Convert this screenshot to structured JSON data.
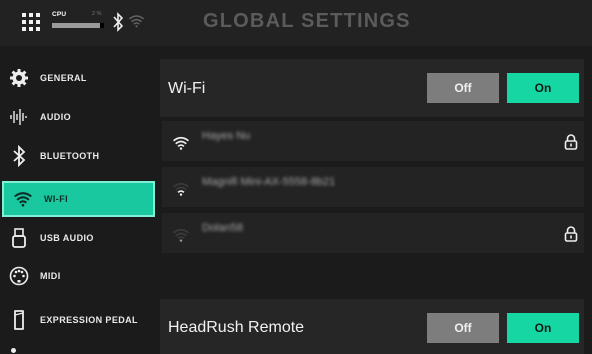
{
  "status_bar": {
    "cpu_label": "CPU",
    "cpu_percent_text": "2 %",
    "cpu_fraction": 0.93
  },
  "page_title": "GLOBAL SETTINGS",
  "sidebar": {
    "items": [
      {
        "label": "GENERAL",
        "icon": "gear-icon"
      },
      {
        "label": "AUDIO",
        "icon": "waveform-icon"
      },
      {
        "label": "BLUETOOTH",
        "icon": "bluetooth-icon"
      },
      {
        "label": "WI-FI",
        "icon": "wifi-icon",
        "active": true
      },
      {
        "label": "USB AUDIO",
        "icon": "usb-icon"
      },
      {
        "label": "MIDI",
        "icon": "midi-icon"
      },
      {
        "label": "EXPRESSION PEDAL",
        "icon": "pedal-icon"
      }
    ]
  },
  "wifi": {
    "label": "Wi-Fi",
    "off_label": "Off",
    "on_label": "On",
    "networks": [
      {
        "name": "Hayes Nu",
        "secured": true,
        "signal": "full"
      },
      {
        "name": "Magnifi Mini-AX-5558-8b21",
        "secured": false,
        "signal": "low"
      },
      {
        "name": "Dolan58",
        "secured": true,
        "signal": "faint"
      }
    ]
  },
  "headrush_remote": {
    "label": "HeadRush Remote",
    "off_label": "Off",
    "on_label": "On"
  },
  "colors": {
    "accent": "#16d6a3",
    "toggle_off": "#7d7d7d",
    "background": "#1b1b1b"
  }
}
